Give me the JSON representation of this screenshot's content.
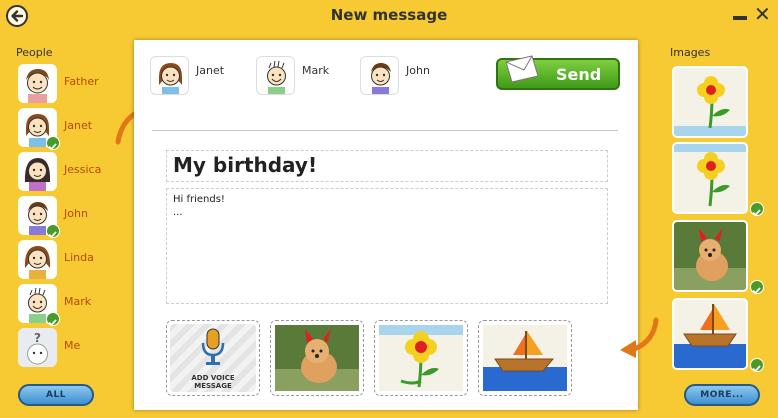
{
  "header": {
    "title": "New message"
  },
  "people": {
    "label": "People",
    "items": [
      {
        "name": "Father",
        "selected": false
      },
      {
        "name": "Janet",
        "selected": true
      },
      {
        "name": "Jessica",
        "selected": false
      },
      {
        "name": "John",
        "selected": true
      },
      {
        "name": "Linda",
        "selected": false
      },
      {
        "name": "Mark",
        "selected": true
      },
      {
        "name": "Me",
        "selected": false
      }
    ],
    "all_label": "ALL"
  },
  "images": {
    "label": "Images",
    "more_label": "MORE...",
    "items": [
      {
        "kind": "flower",
        "selected": false
      },
      {
        "kind": "flower",
        "selected": true
      },
      {
        "kind": "puppy",
        "selected": true
      },
      {
        "kind": "boat",
        "selected": true
      }
    ]
  },
  "message": {
    "recipients": [
      "Janet",
      "Mark",
      "John"
    ],
    "send_label": "Send",
    "subject": "My birthday!",
    "body": "Hi friends!\n...",
    "voice_label": "ADD VOICE\nMESSAGE"
  },
  "colors": {
    "background": "#f7c932",
    "accent": "#4a9a2a",
    "name_text": "#b54a0c"
  }
}
